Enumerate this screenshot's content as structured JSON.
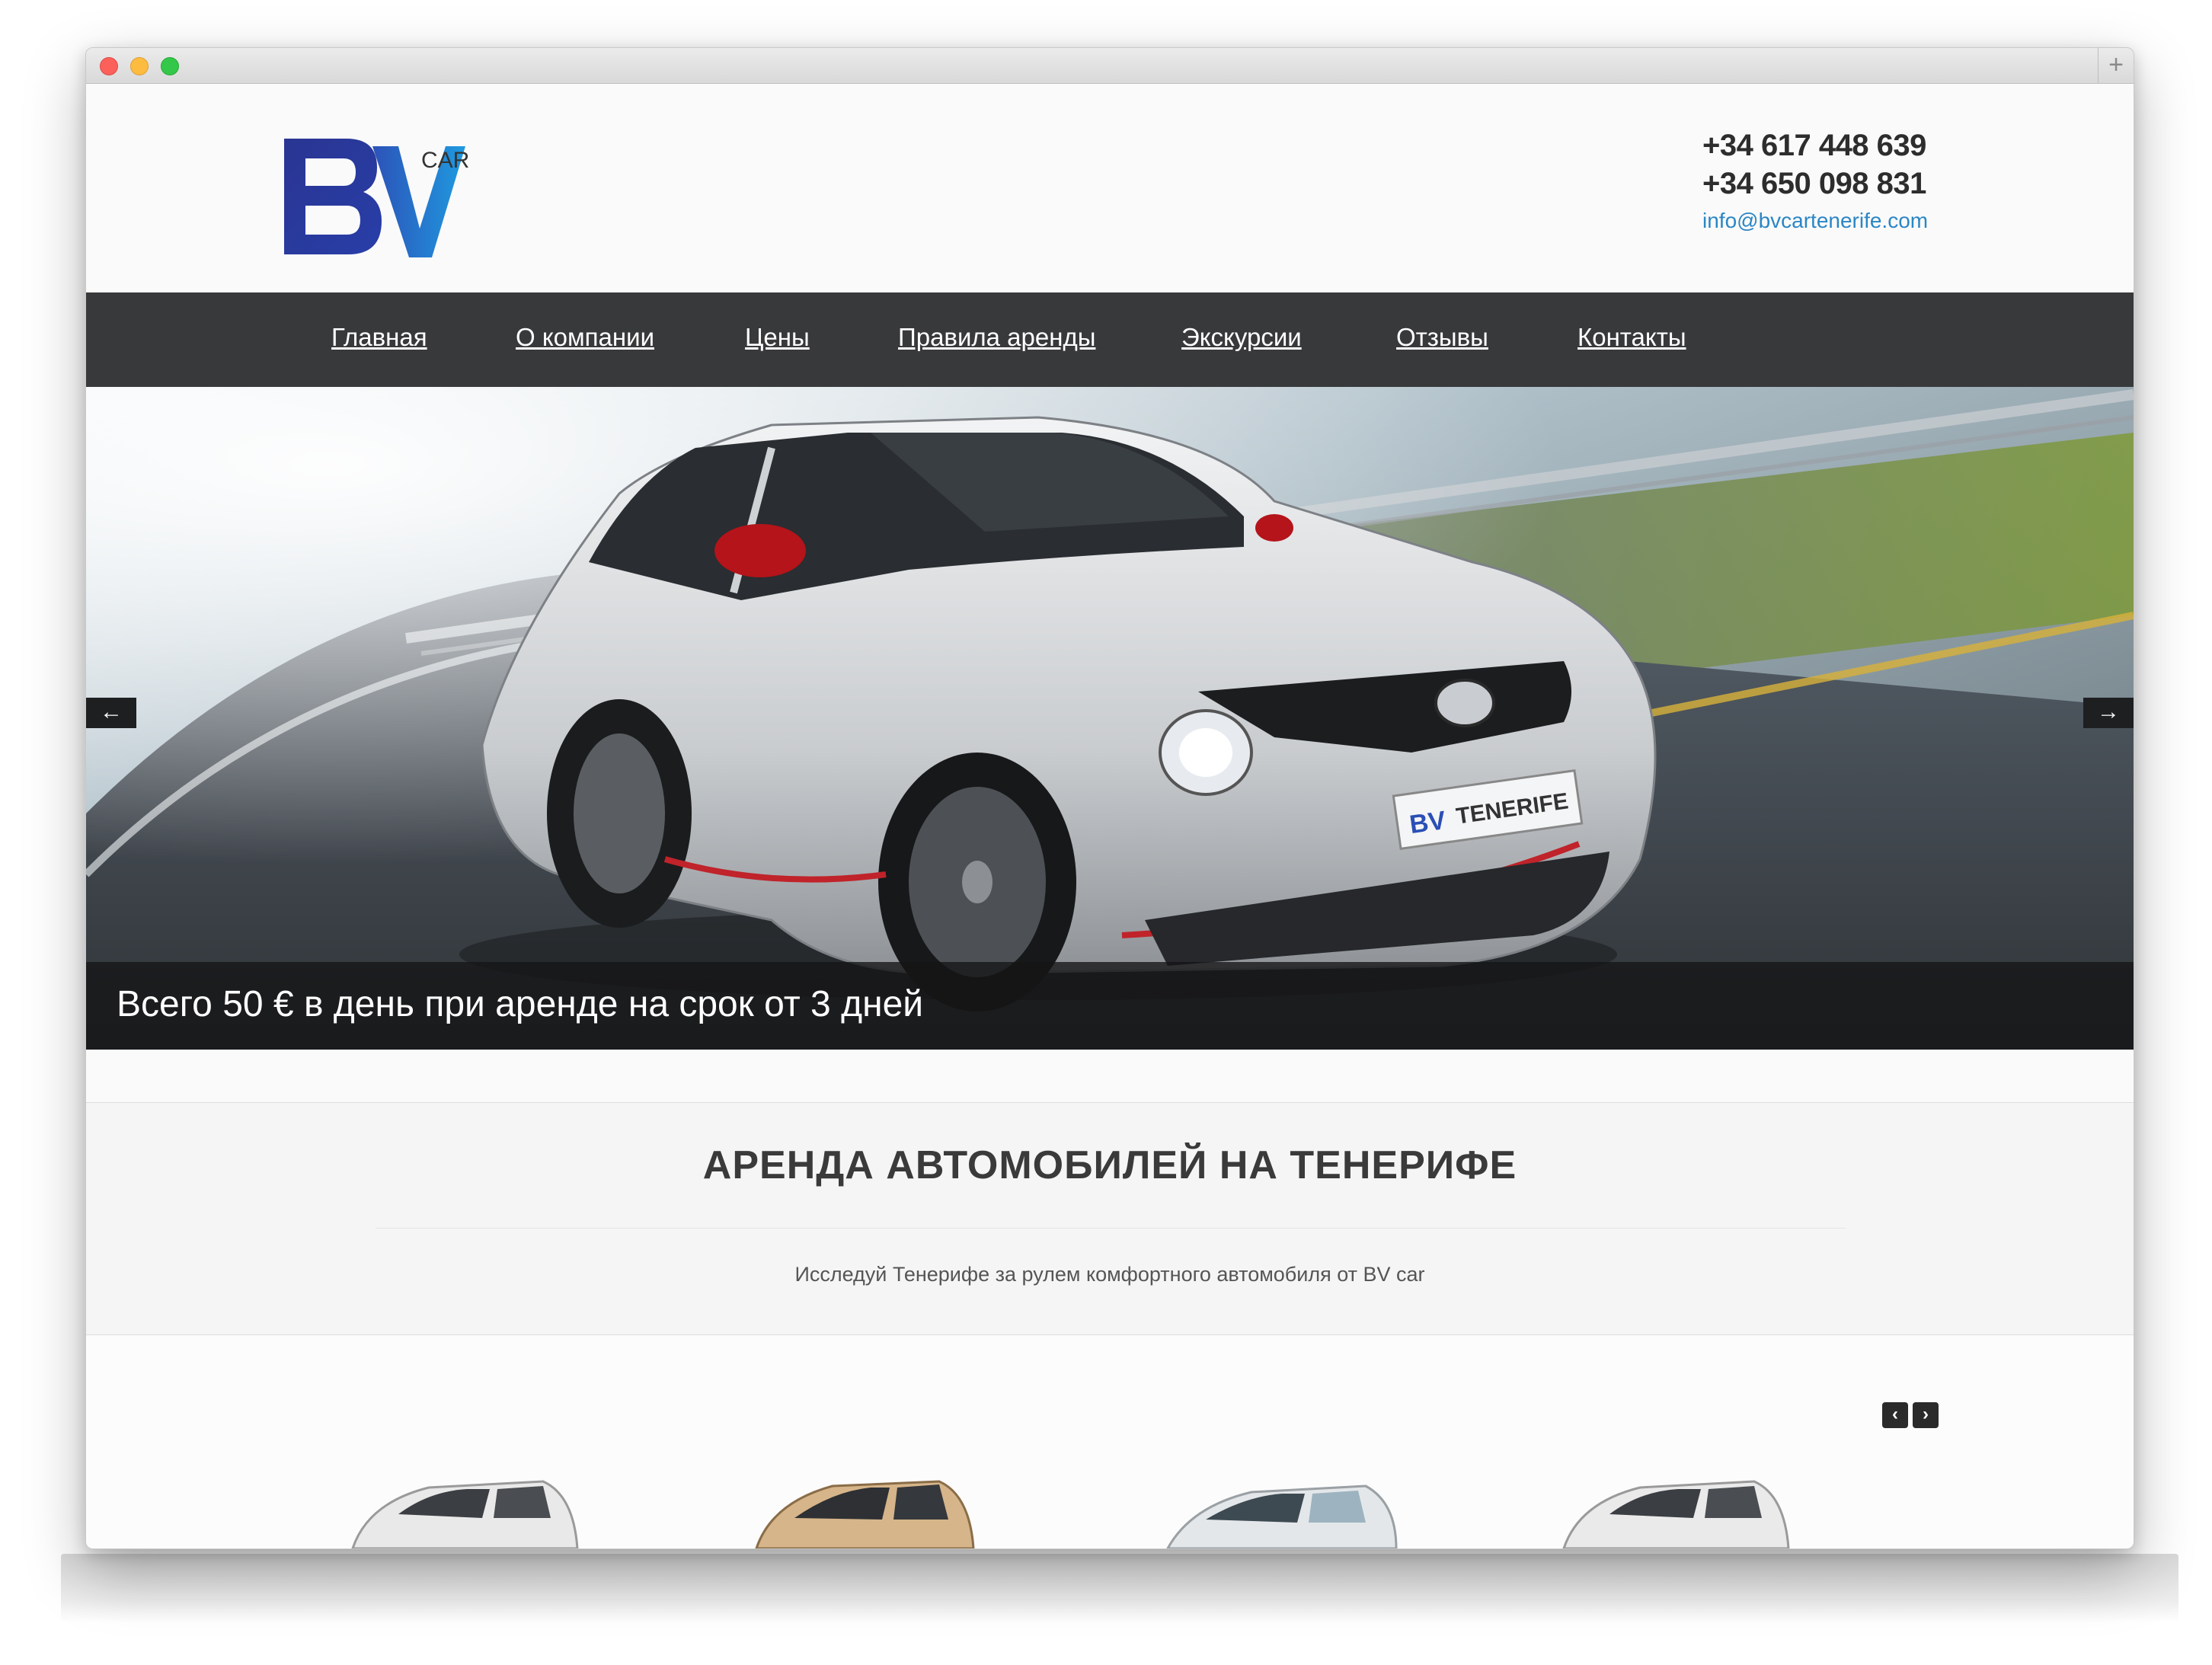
{
  "header": {
    "logo_letters": "BV",
    "logo_sub": "CAR",
    "phone1": "+34 617 448 639",
    "phone2": "+34 650 098 831",
    "email": "info@bvcartenerife.com"
  },
  "nav": {
    "items": [
      {
        "label": "Главная"
      },
      {
        "label": "О компании"
      },
      {
        "label": "Цены"
      },
      {
        "label": "Правила аренды"
      },
      {
        "label": "Экскурсии"
      },
      {
        "label": "Отзывы"
      },
      {
        "label": "Контакты"
      }
    ]
  },
  "hero": {
    "prev_label": "←",
    "next_label": "→",
    "plate_text": "TENERIFE",
    "plate_logo": "BV",
    "caption": "Всего 50 € в день при аренде на срок от 3 дней"
  },
  "intro": {
    "title": "АРЕНДА АВТОМОБИЛЕЙ НА ТЕНЕРИФЕ",
    "subtitle": "Исследуй Тенерифе за рулем комфортного автомобиля от BV car"
  },
  "cars": {
    "prev_label": "‹",
    "next_label": "›",
    "thumbs": [
      {
        "color": "#e9e9e9"
      },
      {
        "color": "#d6b58a"
      },
      {
        "color": "#e4e7ea"
      },
      {
        "color": "#eaeaea"
      }
    ]
  },
  "colors": {
    "nav_bg": "#38393b",
    "email_link": "#2b86c5",
    "logo_dark": "#2a3592",
    "logo_light": "#1f8fd6"
  }
}
